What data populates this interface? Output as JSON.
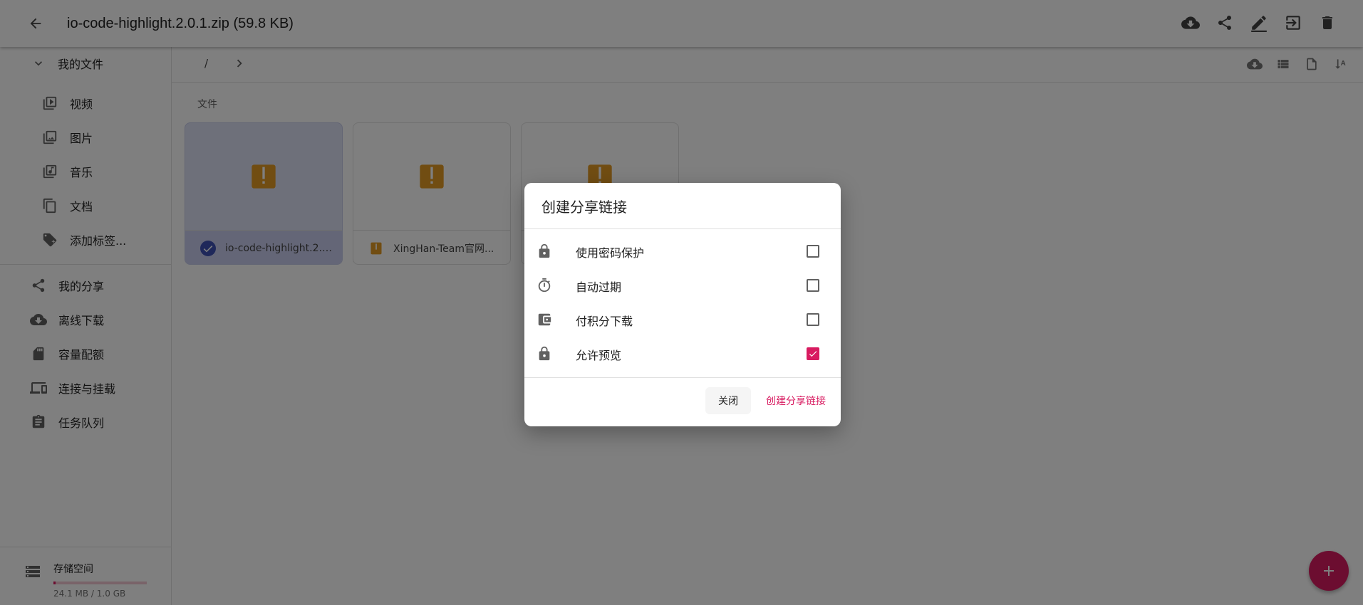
{
  "appbar": {
    "title": "io-code-highlight.2.0.1.zip (59.8 KB)",
    "actions": [
      "download-icon",
      "share-icon",
      "rename-icon",
      "move-icon",
      "delete-icon"
    ]
  },
  "sidebar": {
    "my_files": "我的文件",
    "categories": [
      {
        "label": "视频",
        "icon": "video-icon"
      },
      {
        "label": "图片",
        "icon": "image-icon"
      },
      {
        "label": "音乐",
        "icon": "music-icon"
      },
      {
        "label": "文档",
        "icon": "document-icon"
      },
      {
        "label": "添加标签...",
        "icon": "add-tag-icon"
      }
    ],
    "items": [
      {
        "label": "我的分享",
        "icon": "share-icon"
      },
      {
        "label": "离线下载",
        "icon": "cloud-download-icon"
      },
      {
        "label": "容量配额",
        "icon": "sd-card-icon"
      },
      {
        "label": "连接与挂载",
        "icon": "devices-icon"
      },
      {
        "label": "任务队列",
        "icon": "clipboard-icon"
      }
    ],
    "storage": {
      "label": "存储空间",
      "usage": "24.1 MB / 1.0 GB",
      "used_fraction": 0.024
    }
  },
  "main": {
    "breadcrumb_root": "/",
    "section_label": "文件",
    "files": [
      {
        "name": "io-code-highlight.2.0...",
        "selected": true
      },
      {
        "name": "XingHan-Team官网...",
        "selected": false
      },
      {
        "name": "",
        "selected": false
      }
    ]
  },
  "dialog": {
    "title": "创建分享链接",
    "options": [
      {
        "label": "使用密码保护",
        "icon": "lock-icon",
        "checked": false
      },
      {
        "label": "自动过期",
        "icon": "timer-icon",
        "checked": false
      },
      {
        "label": "付积分下载",
        "icon": "wallet-icon",
        "checked": false
      },
      {
        "label": "允许预览",
        "icon": "lock-icon",
        "checked": true
      }
    ],
    "close_label": "关闭",
    "create_label": "创建分享链接"
  },
  "colors": {
    "accent": "#d81b60",
    "zip_icon": "#e39a24",
    "selected_card": "#dde0f5"
  }
}
